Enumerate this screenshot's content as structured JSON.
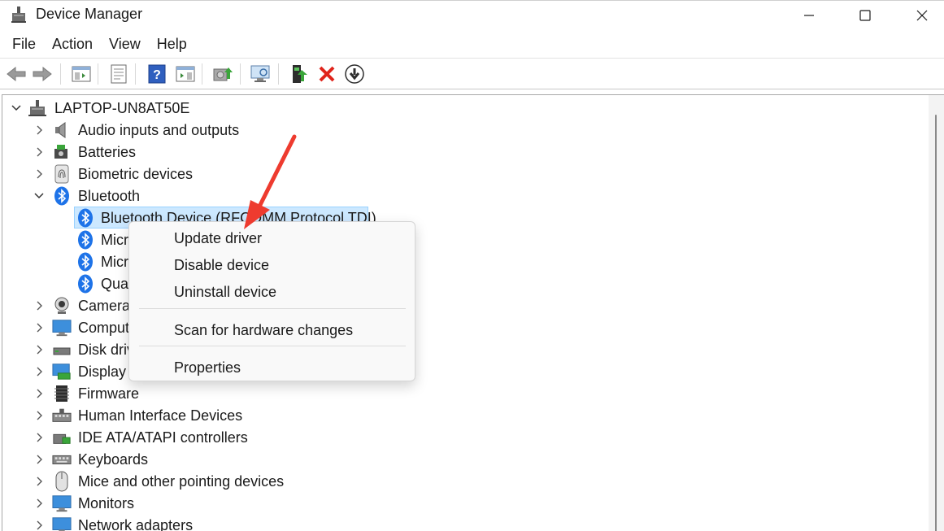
{
  "window": {
    "title": "Device Manager"
  },
  "menu": [
    "File",
    "Action",
    "View",
    "Help"
  ],
  "toolbar_icons": [
    "back-arrow-icon",
    "forward-arrow-icon",
    "show-hide-tree-icon",
    "properties-icon",
    "help-icon",
    "action-pane-icon",
    "update-driver-icon",
    "scan-hardware-icon",
    "enable-device-icon",
    "uninstall-icon",
    "disable-device-icon"
  ],
  "tree": {
    "root": "LAPTOP-UN8AT50E",
    "categories": [
      {
        "label": "Audio inputs and outputs",
        "icon": "speaker-icon"
      },
      {
        "label": "Batteries",
        "icon": "battery-icon"
      },
      {
        "label": "Biometric devices",
        "icon": "fingerprint-icon"
      },
      {
        "label": "Bluetooth",
        "icon": "bluetooth-icon"
      },
      {
        "label": "Cameras",
        "icon": "camera-icon"
      },
      {
        "label": "Comput",
        "icon": "monitor-icon"
      },
      {
        "label": "Disk driv",
        "icon": "disk-drive-icon"
      },
      {
        "label": "Display",
        "icon": "display-adapter-icon"
      },
      {
        "label": "Firmware",
        "icon": "firmware-icon"
      },
      {
        "label": "Human Interface Devices",
        "icon": "hid-icon"
      },
      {
        "label": "IDE ATA/ATAPI controllers",
        "icon": "ide-controller-icon"
      },
      {
        "label": "Keyboards",
        "icon": "keyboard-icon"
      },
      {
        "label": "Mice and other pointing devices",
        "icon": "mouse-icon"
      },
      {
        "label": "Monitors",
        "icon": "monitor-icon"
      },
      {
        "label": "Network adapters",
        "icon": "network-adapter-icon"
      }
    ],
    "bluetooth_children": [
      "Bluetooth Device (RFCOMM Protocol TDI)",
      "Micr",
      "Micr",
      "Qua"
    ]
  },
  "context_menu": {
    "items": [
      "Update driver",
      "Disable device",
      "Uninstall device",
      "Scan for hardware changes",
      "Properties"
    ]
  },
  "colors": {
    "selection": "#cce8ff",
    "annotation_arrow": "#ee3b2f",
    "bluetooth": "#1e73e8"
  }
}
